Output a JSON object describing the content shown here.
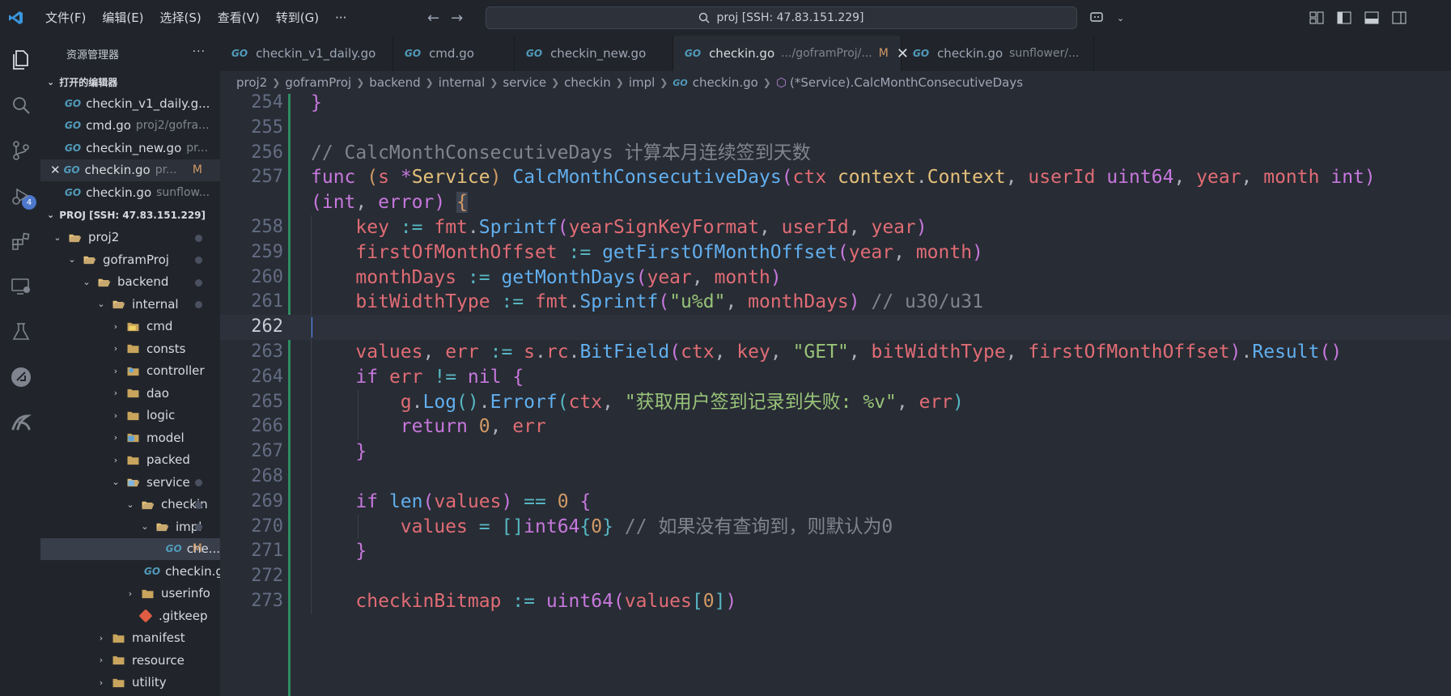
{
  "titlebar": {
    "menus": [
      "文件(F)",
      "编辑(E)",
      "选择(S)",
      "查看(V)",
      "转到(G)",
      "···"
    ],
    "search_text": "proj [SSH: 47.83.151.229]"
  },
  "activity": {
    "scm_badge": "4"
  },
  "sidebar": {
    "title": "资源管理器",
    "more": "···",
    "open_editors_title": "打开的编辑器",
    "open_editors": [
      {
        "name": "checkin_v1_daily.g...",
        "desc": ""
      },
      {
        "name": "cmd.go",
        "desc": "proj2/gofra..."
      },
      {
        "name": "checkin_new.go",
        "desc": "pr..."
      },
      {
        "name": "checkin.go",
        "desc": "pr...",
        "mod": "M"
      },
      {
        "name": "checkin.go",
        "desc": "sunflow..."
      }
    ],
    "project_title": "PROJ [SSH: 47.83.151.229]",
    "tree": [
      {
        "name": "proj2"
      },
      {
        "name": "goframProj"
      },
      {
        "name": "backend"
      },
      {
        "name": "internal"
      },
      {
        "name": "cmd"
      },
      {
        "name": "consts"
      },
      {
        "name": "controller"
      },
      {
        "name": "dao"
      },
      {
        "name": "logic"
      },
      {
        "name": "model"
      },
      {
        "name": "packed"
      },
      {
        "name": "service"
      },
      {
        "name": "checkin"
      },
      {
        "name": "impl"
      },
      {
        "name": "che...",
        "mod": "M"
      },
      {
        "name": "checkin.go"
      },
      {
        "name": "userinfo"
      },
      {
        "name": ".gitkeep"
      },
      {
        "name": "manifest"
      },
      {
        "name": "resource"
      },
      {
        "name": "utility"
      }
    ]
  },
  "tabs": [
    {
      "name": "checkin_v1_daily.go",
      "desc": ""
    },
    {
      "name": "cmd.go",
      "desc": ""
    },
    {
      "name": "checkin_new.go",
      "desc": ""
    },
    {
      "name": "checkin.go",
      "desc": ".../goframProj/...",
      "mod": "M",
      "close": "✕"
    },
    {
      "name": "checkin.go",
      "desc": "sunflower/..."
    }
  ],
  "breadcrumb": [
    "proj2",
    "goframProj",
    "backend",
    "internal",
    "service",
    "checkin",
    "impl",
    "checkin.go",
    "(*Service).CalcMonthConsecutiveDays"
  ],
  "editor": {
    "line_numbers": [
      "254",
      "255",
      "256",
      "257",
      "",
      "258",
      "259",
      "260",
      "261",
      "262",
      "263",
      "264",
      "265",
      "266",
      "267",
      "268",
      "269",
      "270",
      "271",
      "272",
      "273"
    ],
    "current_line": "262"
  }
}
